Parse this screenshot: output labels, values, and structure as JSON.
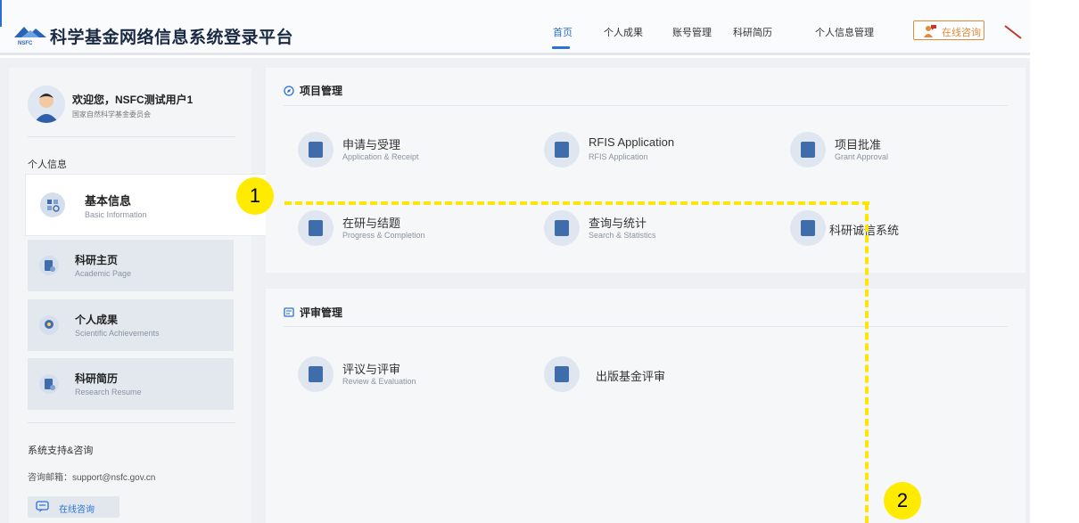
{
  "app": {
    "logo_text": "NSFC",
    "title": "科学基金网络信息系统登录平台"
  },
  "nav": {
    "items": [
      {
        "label": "首页",
        "active": true
      },
      {
        "label": "个人成果",
        "active": false
      },
      {
        "label": "账号管理",
        "active": false
      },
      {
        "label": "科研简历",
        "active": false
      },
      {
        "label": "个人信息管理",
        "active": false
      }
    ],
    "consult_label": "在线咨询"
  },
  "user": {
    "welcome": "欢迎您，NSFC测试用户1",
    "org": "国家自然科学基金委员会"
  },
  "sidebar": {
    "section_label": "个人信息",
    "items": [
      {
        "title": "基本信息",
        "subtitle": "Basic Information",
        "active": true
      },
      {
        "title": "科研主页",
        "subtitle": "Academic Page",
        "active": false
      },
      {
        "title": "个人成果",
        "subtitle": "Scientific Achievements",
        "active": false
      },
      {
        "title": "科研简历",
        "subtitle": "Research Resume",
        "active": false
      }
    ],
    "support_title": "系统支持&咨询",
    "support_mail": "咨询邮箱：support@nsfc.gov.cn",
    "support_button": "在线咨询"
  },
  "project_panel": {
    "heading": "项目管理",
    "tiles": [
      {
        "title": "申请与受理",
        "subtitle": "Application & Receipt"
      },
      {
        "title": "RFIS Application",
        "subtitle": "RFIS Application"
      },
      {
        "title": "项目批准",
        "subtitle": "Grant Approval"
      },
      {
        "title": "在研与结题",
        "subtitle": "Progress & Completion"
      },
      {
        "title": "查询与统计",
        "subtitle": "Search & Statistics"
      },
      {
        "title": "科研诚信系统",
        "subtitle": ""
      }
    ]
  },
  "review_panel": {
    "heading": "评审管理",
    "tiles": [
      {
        "title": "评议与评审",
        "subtitle": "Review & Evaluation"
      },
      {
        "title": "出版基金评审",
        "subtitle": ""
      }
    ]
  },
  "annotations": {
    "callout_1": "1",
    "callout_2": "2",
    "callout_color": "#ffeb00"
  },
  "colors": {
    "accent": "#2a72d6",
    "consult_orange": "#e08a3a",
    "icon_blue": "#3f6dab"
  }
}
